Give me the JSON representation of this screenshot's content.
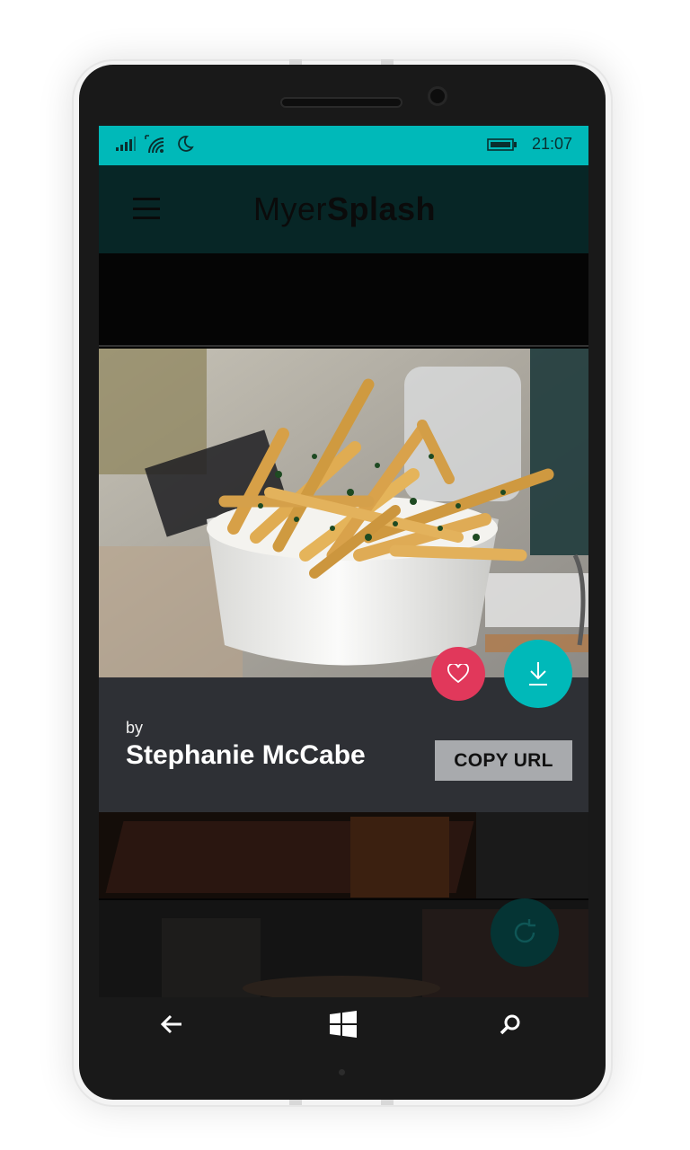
{
  "status_bar": {
    "time": "21:07",
    "icons": [
      "signal-icon",
      "wifi-icon",
      "quiet-hours-icon",
      "battery-icon"
    ]
  },
  "app": {
    "title_part1": "Myer",
    "title_part2": "Splash"
  },
  "photo": {
    "by_label": "by",
    "author": "Stephanie McCabe",
    "copy_url_label": "COPY URL"
  },
  "actions": {
    "like_icon": "heart-icon",
    "download_icon": "download-icon",
    "refresh_icon": "refresh-icon"
  },
  "nav": {
    "back_icon": "back-arrow-icon",
    "start_icon": "windows-logo-icon",
    "search_icon": "search-icon"
  },
  "colors": {
    "accent": "#00b9b9",
    "like": "#e1385b",
    "panel": "#2e3035"
  }
}
